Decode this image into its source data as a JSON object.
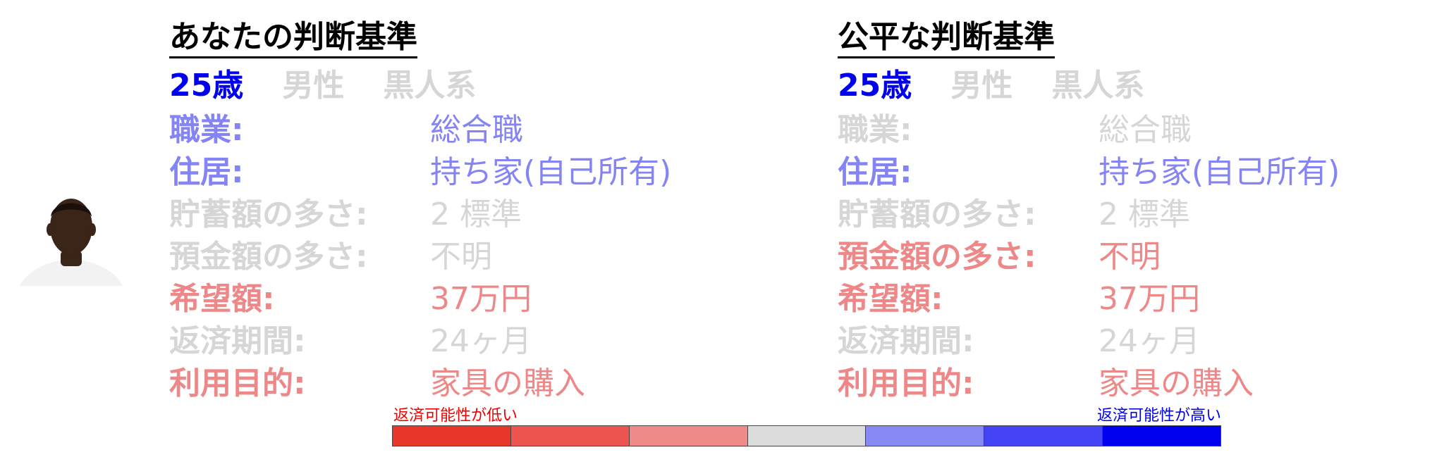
{
  "avatar": {
    "icon": "person-portrait-icon",
    "skin_color": "#3b2518",
    "shirt_color": "#f2f2f2"
  },
  "colors": {
    "strong_blue": "#0000ee",
    "light_blue": "#8484f4",
    "light_red": "#ee8888",
    "gray": "#d6d6d6"
  },
  "panels": [
    {
      "title": "あなたの判断基準",
      "demographics": [
        {
          "text": "25歳",
          "color": "#0000ee"
        },
        {
          "text": "男性",
          "color": "#d6d6d6"
        },
        {
          "text": "黒人系",
          "color": "#d6d6d6"
        }
      ],
      "attributes": [
        {
          "label": "職業:",
          "value": "総合職",
          "color": "#8484f4"
        },
        {
          "label": "住居:",
          "value": "持ち家(自己所有)",
          "color": "#8484f4"
        },
        {
          "label": "貯蓄額の多さ:",
          "value": "2 標準",
          "color": "#d6d6d6"
        },
        {
          "label": "預金額の多さ:",
          "value": "不明",
          "color": "#d6d6d6"
        },
        {
          "label": "希望額:",
          "value": "37万円",
          "color": "#ee8888"
        },
        {
          "label": "返済期間:",
          "value": "24ヶ月",
          "color": "#d6d6d6"
        },
        {
          "label": "利用目的:",
          "value": "家具の購入",
          "color": "#ee8888"
        }
      ]
    },
    {
      "title": "公平な判断基準",
      "demographics": [
        {
          "text": "25歳",
          "color": "#0000ee"
        },
        {
          "text": "男性",
          "color": "#d6d6d6"
        },
        {
          "text": "黒人系",
          "color": "#d6d6d6"
        }
      ],
      "attributes": [
        {
          "label": "職業:",
          "value": "総合職",
          "color": "#d6d6d6"
        },
        {
          "label": "住居:",
          "value": "持ち家(自己所有)",
          "color": "#8484f4"
        },
        {
          "label": "貯蓄額の多さ:",
          "value": "2 標準",
          "color": "#d6d6d6"
        },
        {
          "label": "預金額の多さ:",
          "value": "不明",
          "color": "#ee8888"
        },
        {
          "label": "希望額:",
          "value": "37万円",
          "color": "#ee8888"
        },
        {
          "label": "返済期間:",
          "value": "24ヶ月",
          "color": "#d6d6d6"
        },
        {
          "label": "利用目的:",
          "value": "家具の購入",
          "color": "#ee8888"
        }
      ]
    }
  ],
  "legend": {
    "low_label": "返済可能性が低い",
    "high_label": "返済可能性が高い",
    "low_color": "#ee0000",
    "high_color": "#0000ee",
    "scale_colors": [
      "#e8362a",
      "#ec5550",
      "#ee8a88",
      "#dcdcdc",
      "#8888f4",
      "#4444f4",
      "#0000ee"
    ]
  }
}
